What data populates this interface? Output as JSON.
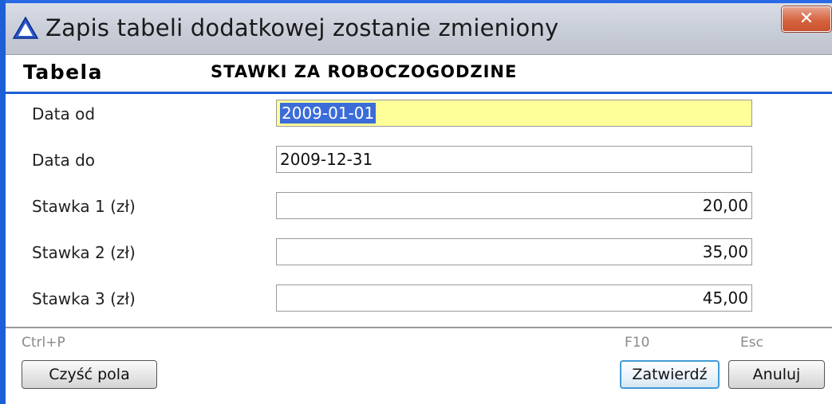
{
  "window": {
    "title": "Zapis tabeli dodatkowej zostanie zmieniony",
    "close_label": "✕"
  },
  "header": {
    "label": "Tabela",
    "value": "STAWKI ZA ROBOCZOGODZINE"
  },
  "form": {
    "fields": [
      {
        "label": "Data od",
        "value": "2009-01-01"
      },
      {
        "label": "Data do",
        "value": "2009-12-31"
      },
      {
        "label": "Stawka 1 (zł)",
        "value": "20,00"
      },
      {
        "label": "Stawka 2 (zł)",
        "value": "35,00"
      },
      {
        "label": "Stawka 3 (zł)",
        "value": "45,00"
      }
    ]
  },
  "footer": {
    "clear": {
      "shortcut": "Ctrl+P",
      "label": "Czyść pola"
    },
    "confirm": {
      "shortcut": "F10",
      "label": "Zatwierdź"
    },
    "cancel": {
      "shortcut": "Esc",
      "label": "Anuluj"
    }
  },
  "colors": {
    "active_field": "#ffff99",
    "selection": "#3b6cd8",
    "frame": "#1d5fd7"
  }
}
